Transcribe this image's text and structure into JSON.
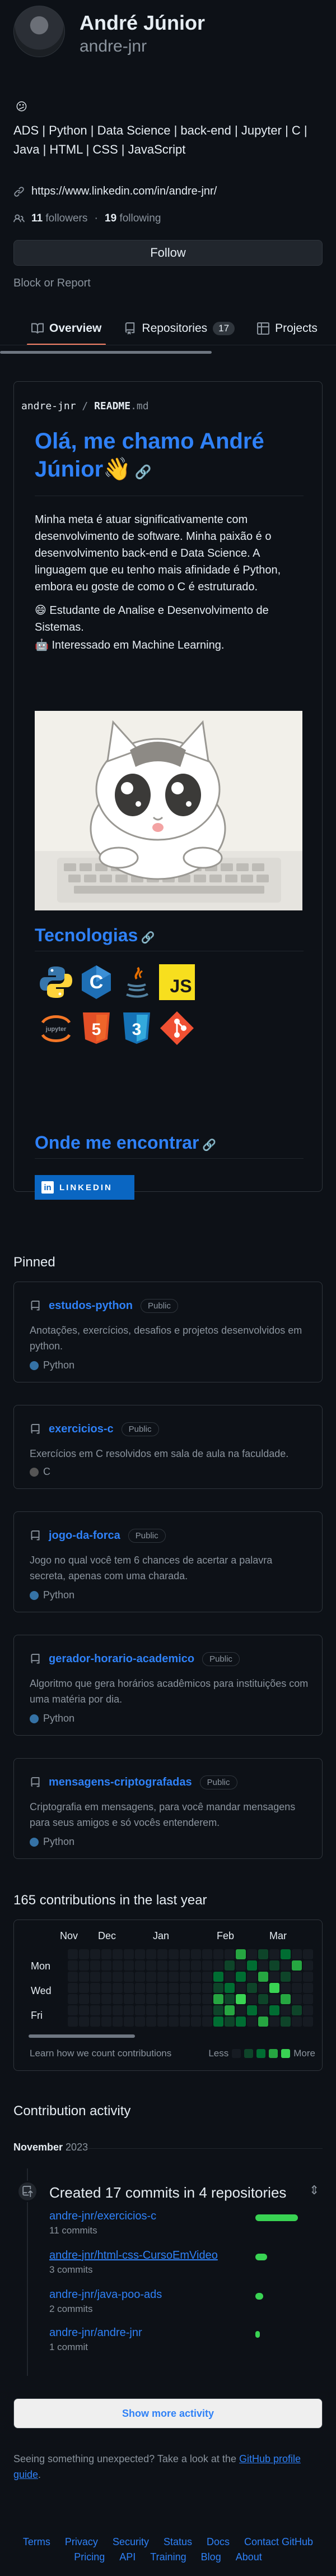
{
  "profile": {
    "full_name": "André Júnior",
    "username": "andre-jnr",
    "status_emoji": "😕",
    "bio": "ADS | Python | Data Science | back-end | Jupyter | C | Java | HTML | CSS | JavaScript",
    "website": "https://www.linkedin.com/in/andre-jnr/",
    "followers_count": "11",
    "followers_label": "followers",
    "following_count": "19",
    "following_label": "following",
    "follow_label": "Follow",
    "block_label": "Block or Report"
  },
  "tabs": [
    {
      "label": "Overview",
      "icon": "book-icon"
    },
    {
      "label": "Repositories",
      "icon": "repo-icon",
      "count": "17"
    },
    {
      "label": "Projects",
      "icon": "table-icon"
    }
  ],
  "readme": {
    "owner": "andre-jnr",
    "file": "README",
    "ext": ".md",
    "title": "Olá, me chamo André Júnior👋",
    "intro": "Minha meta é atuar significativamente com desenvolvimento de software. Minha paixão é o desenvolvimento back-end e Data Science. A linguagem que eu tenho mais afinidade é Python, embora eu goste de como o C é estruturado.",
    "bullet_1": "😄 Estudante de Analise e Desenvolvimento de Sistemas.",
    "bullet_2": "🤖 Interessado em Machine Learning.",
    "tech_heading": "Tecnologias",
    "technologies": [
      "Python",
      "C",
      "Java",
      "JS",
      "Jupyter",
      "HTML5",
      "CSS3",
      "Git"
    ],
    "contact_heading": "Onde me encontrar",
    "linkedin_badge": "LINKEDIN"
  },
  "pinned": {
    "title": "Pinned",
    "items": [
      {
        "name": "estudos-python",
        "visibility": "Public",
        "desc": "Anotações, exercícios, desafios e projetos desenvolvidos em python.",
        "lang": "Python",
        "lang_color": "#3572a5"
      },
      {
        "name": "exercicios-c",
        "visibility": "Public",
        "desc": "Exercícios em C resolvidos em sala de aula na faculdade.",
        "lang": "C",
        "lang_color": "#555555"
      },
      {
        "name": "jogo-da-forca",
        "visibility": "Public",
        "desc": "Jogo no qual você tem 6 chances de acertar a palavra secreta, apenas com uma charada.",
        "lang": "Python",
        "lang_color": "#3572a5"
      },
      {
        "name": "gerador-horario-academico",
        "visibility": "Public",
        "desc": "Algoritmo que gera horários acadêmicos para instituições com uma matéria por dia.",
        "lang": "Python",
        "lang_color": "#3572a5"
      },
      {
        "name": "mensagens-criptografadas",
        "visibility": "Public",
        "desc": "Criptografia em mensagens, para você mandar mensagens para seus amigos e só vocês entenderem.",
        "lang": "Python",
        "lang_color": "#3572a5"
      }
    ]
  },
  "contributions": {
    "title": "165 contributions in the last year",
    "months": [
      "Nov",
      "Dec",
      "Jan",
      "Feb",
      "Mar"
    ],
    "days": [
      "Mon",
      "Wed",
      "Fri"
    ],
    "learn_label": "Learn how we count contributions",
    "less_label": "Less",
    "more_label": "More",
    "colors": [
      "#161b22",
      "#0e4429",
      "#006d32",
      "#26a641",
      "#39d353"
    ]
  },
  "activity": {
    "title": "Contribution activity",
    "month": "November",
    "year": "2023",
    "commit_title": "Created 17 commits in 4 repositories",
    "repos": [
      {
        "name": "andre-jnr/exercicios-c",
        "commits": "11 commits",
        "share": 11
      },
      {
        "name": "andre-jnr/html-css-CursoEmVideo",
        "commits": "3 commits",
        "share": 3
      },
      {
        "name": "andre-jnr/java-poo-ads",
        "commits": "2 commits",
        "share": 2
      },
      {
        "name": "andre-jnr/andre-jnr",
        "commits": "1 commit",
        "share": 1
      }
    ],
    "show_more": "Show more activity",
    "feedback_text": "Seeing something unexpected? Take a look at the",
    "feedback_link": "GitHub profile guide",
    "feedback_end": "."
  },
  "footer": [
    "Terms",
    "Privacy",
    "Security",
    "Status",
    "Docs",
    "Contact GitHub",
    "Pricing",
    "API",
    "Training",
    "Blog",
    "About"
  ]
}
